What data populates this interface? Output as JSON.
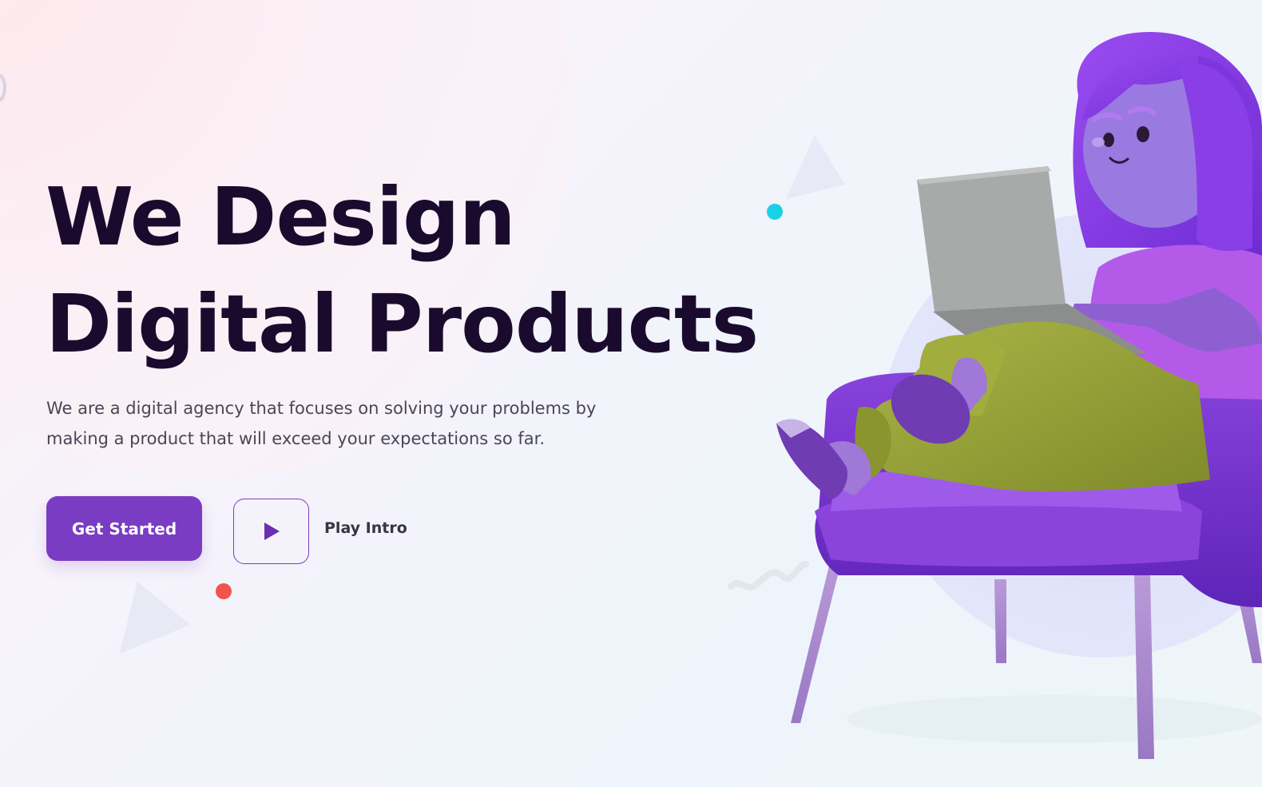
{
  "hero": {
    "headline_line1": "We Design",
    "headline_line2": "Digital Products",
    "subtitle": "We are a digital agency that focuses on solving your problems by making a product that will exceed your expectations so far.",
    "cta_primary": "Get Started",
    "cta_secondary": "Play Intro"
  },
  "icons": {
    "play": "play-icon"
  },
  "colors": {
    "accent": "#7a3cc2",
    "heading": "#1a0b2e",
    "body_text": "#4b4556",
    "dot_cyan": "#1ad0e6",
    "dot_red": "#f0433a",
    "hair": "#8a3fe6",
    "shirt": "#b45ae8",
    "pants": "#9aa13a",
    "chair": "#7a36d4",
    "laptop": "#a7aaa9"
  }
}
